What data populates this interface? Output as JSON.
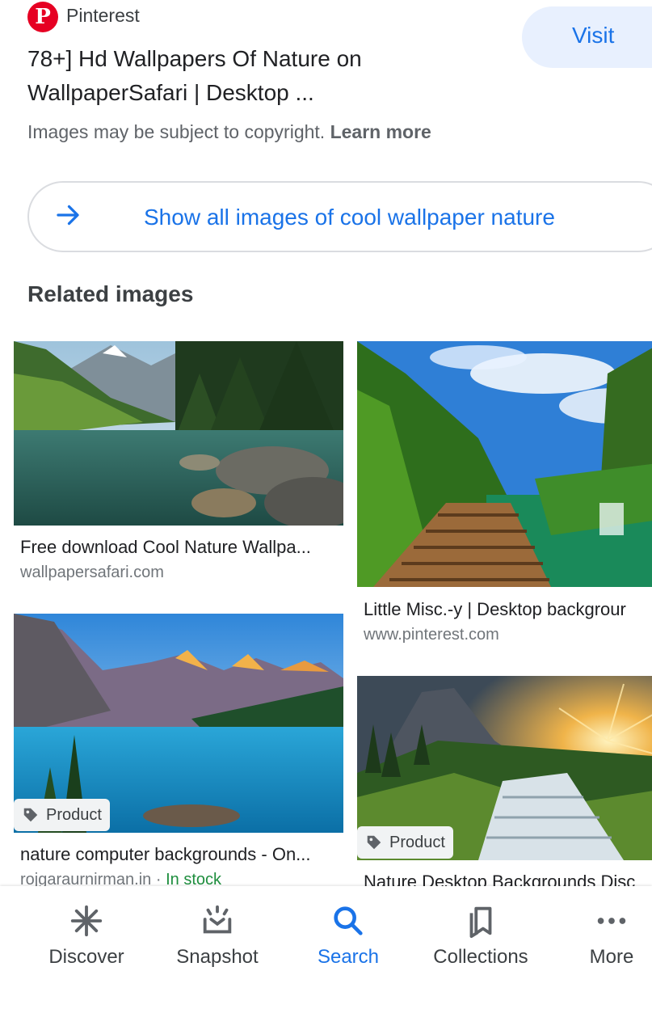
{
  "header": {
    "source_name": "Pinterest",
    "visit_label": "Visit",
    "title": "78+] Hd Wallpapers Of Nature on WallpaperSafari | Desktop ...",
    "copyright_text": "Images may be subject to copyright.",
    "learn_more": "Learn more"
  },
  "show_all": {
    "label": "Show all images of cool wallpaper nature"
  },
  "related": {
    "heading": "Related images",
    "cards": [
      {
        "title": "Free download Cool Nature Wallpa...",
        "site": "wallpapersafari.com",
        "image": "mountain-lake-forest"
      },
      {
        "title": "Little Misc.-y | Desktop backgrour",
        "site": "www.pinterest.com",
        "image": "wooden-boardwalk-waterfall"
      },
      {
        "title": "nature computer backgrounds - On...",
        "site": "rojgaraurnirman.in",
        "stock": "In stock",
        "tag": "Product",
        "image": "moraine-lake"
      },
      {
        "title": "Nature Desktop Backgrounds Disc",
        "tag": "Product",
        "image": "sunset-waterfall"
      }
    ]
  },
  "bottom_nav": [
    {
      "label": "Discover",
      "icon": "asterisk-icon"
    },
    {
      "label": "Snapshot",
      "icon": "snapshot-icon"
    },
    {
      "label": "Search",
      "icon": "search-icon",
      "active": true
    },
    {
      "label": "Collections",
      "icon": "collections-icon"
    },
    {
      "label": "More",
      "icon": "more-dots-icon"
    }
  ],
  "colors": {
    "accent": "#1a73e8",
    "pinterest": "#e60023",
    "in_stock": "#1e8e3e"
  }
}
